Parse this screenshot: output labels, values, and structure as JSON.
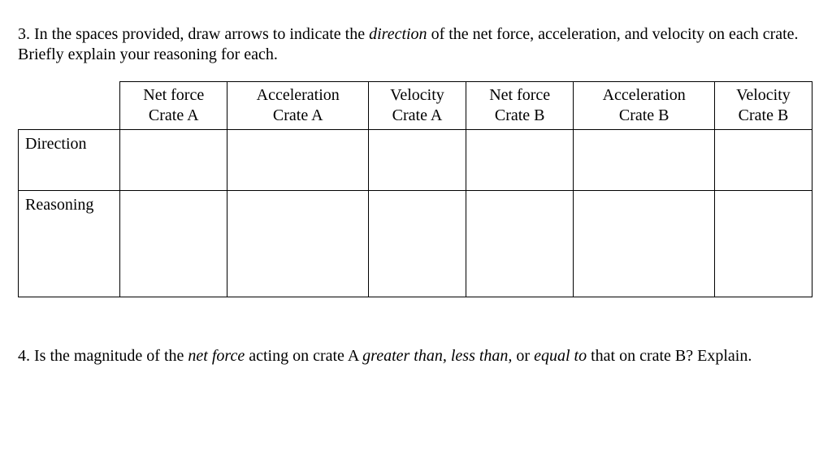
{
  "q3": {
    "prefix": "3. In the spaces provided, draw arrows to indicate the ",
    "italic1": "direction",
    "rest": " of the net force, acceleration, and velocity on each crate. Briefly explain your reasoning for each."
  },
  "table": {
    "headers": [
      {
        "line1": "Net force",
        "line2": "Crate A"
      },
      {
        "line1": "Acceleration",
        "line2": "Crate A"
      },
      {
        "line1": "Velocity",
        "line2": "Crate A"
      },
      {
        "line1": "Net force",
        "line2": "Crate B"
      },
      {
        "line1": "Acceleration",
        "line2": "Crate B"
      },
      {
        "line1": "Velocity",
        "line2": "Crate B"
      }
    ],
    "row1_label": "Direction",
    "row2_label": "Reasoning"
  },
  "q4": {
    "prefix": "4. Is the magnitude of the ",
    "italic1": "net force",
    "mid1": " acting on crate A ",
    "italic2": "greater than, less than,",
    "mid2": " or ",
    "italic3": "equal to",
    "rest": " that on crate B?  Explain."
  }
}
